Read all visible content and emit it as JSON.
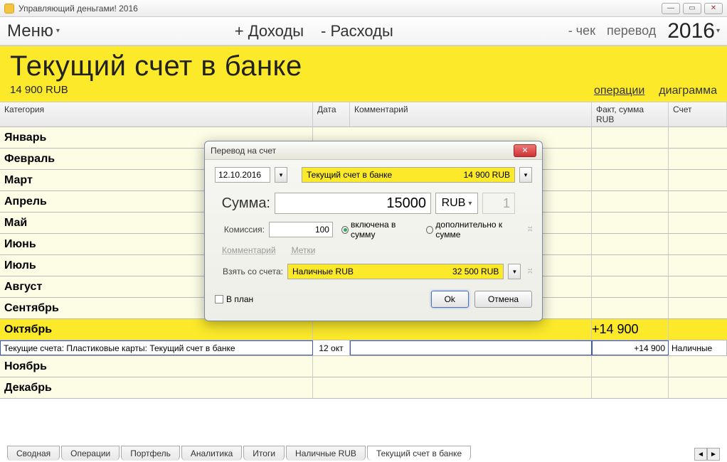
{
  "window": {
    "title": "Управляющий деньгами! 2016"
  },
  "toolbar": {
    "menu": "Меню",
    "income": "+ Доходы",
    "expense": "- Расходы",
    "check": "- чек",
    "transfer": "перевод",
    "year": "2016"
  },
  "account": {
    "title": "Текущий счет в банке",
    "balance": "14 900 RUB",
    "tabs": {
      "ops": "операции",
      "chart": "диаграмма"
    }
  },
  "columns": {
    "category": "Категория",
    "date": "Дата",
    "comment": "Комментарий",
    "sum": "Факт, сумма RUB",
    "acct": "Счет"
  },
  "months": {
    "jan": "Январь",
    "feb": "Февраль",
    "mar": "Март",
    "apr": "Апрель",
    "may": "Май",
    "jun": "Июнь",
    "jul": "Июль",
    "aug": "Август",
    "sep": "Сентябрь",
    "oct": "Октябрь",
    "nov": "Ноябрь",
    "dec": "Декабрь"
  },
  "oct_total": "+14 900",
  "op": {
    "category": "Текущие счета: Пластиковые карты: Текущий счет в банке",
    "date": "12 окт",
    "sum": "+14 900",
    "acct": "Наличные"
  },
  "bottom_tabs": [
    "Сводная",
    "Операции",
    "Портфель",
    "Аналитика",
    "Итоги",
    "Наличные RUB",
    "Текущий счет в банке"
  ],
  "dialog": {
    "title": "Перевод на счет",
    "date": "12.10.2016",
    "to_account": "Текущий счет в банке",
    "to_balance": "14 900 RUB",
    "sum_label": "Сумма:",
    "sum_value": "15000",
    "currency": "RUB",
    "rate": "1",
    "fee_label": "Комиссия:",
    "fee_value": "100",
    "fee_included": "включена в сумму",
    "fee_extra": "дополнительно к сумме",
    "comment_link": "Комментарий",
    "tags_link": "Метки",
    "from_label": "Взять со счета:",
    "from_account": "Наличные RUB",
    "from_balance": "32 500 RUB",
    "plan_label": "В план",
    "ok": "Ok",
    "cancel": "Отмена"
  }
}
